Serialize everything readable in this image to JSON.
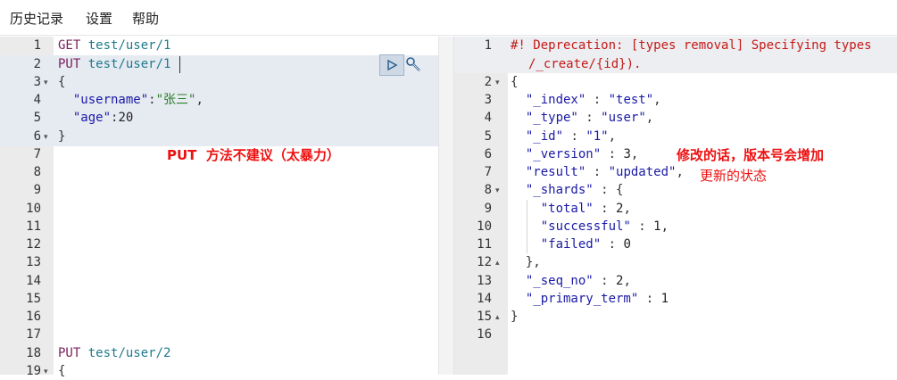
{
  "menu": {
    "history": "历史记录",
    "settings": "设置",
    "help": "帮助"
  },
  "left": {
    "line_numbers": [
      "1",
      "2",
      "3",
      "4",
      "5",
      "6",
      "7",
      "8",
      "9",
      "10",
      "11",
      "12",
      "13",
      "14",
      "15",
      "16",
      "17",
      "18",
      "19"
    ],
    "lines": {
      "l1_method": "GET",
      "l1_url": "test/user/1",
      "l2_method": "PUT",
      "l2_url": "test/user/1",
      "l3": "{",
      "l4_key": "\"username\"",
      "l4_colon": ":",
      "l4_val": "\"张三\"",
      "l4_comma": ",",
      "l5_key": "\"age\"",
      "l5_colon": ":",
      "l5_val": "20",
      "l6": "}",
      "l18_method": "PUT",
      "l18_url": "test/user/2",
      "l19": "{"
    },
    "annotation": "PUT  方法不建议（太暴力）",
    "icons": {
      "run": "play-icon",
      "wrench": "wrench-icon"
    }
  },
  "right": {
    "line_numbers": [
      "1",
      "",
      "2",
      "3",
      "4",
      "5",
      "6",
      "7",
      "8",
      "9",
      "10",
      "11",
      "12",
      "13",
      "14",
      "15",
      "16"
    ],
    "deprecation_line1": "#! Deprecation: [types removal] Specifying types",
    "deprecation_line2": "/_create/{id}).",
    "lines": {
      "l2": "{",
      "l3_key": "\"_index\"",
      "l3_val": "\"test\"",
      "l4_key": "\"_type\"",
      "l4_val": "\"user\"",
      "l5_key": "\"_id\"",
      "l5_val": "\"1\"",
      "l6_key": "\"_version\"",
      "l6_val": "3",
      "l7_key": "\"result\"",
      "l7_val": "\"updated\"",
      "l8_key": "\"_shards\"",
      "l8_open": "{",
      "l9_key": "\"total\"",
      "l9_val": "2",
      "l10_key": "\"successful\"",
      "l10_val": "1",
      "l11_key": "\"failed\"",
      "l11_val": "0",
      "l12": "},",
      "l13_key": "\"_seq_no\"",
      "l13_val": "2",
      "l14_key": "\"_primary_term\"",
      "l14_val": "1",
      "l15": "}"
    },
    "annotation_version": "修改的话，版本号会增加",
    "annotation_result": "更新的状态"
  }
}
